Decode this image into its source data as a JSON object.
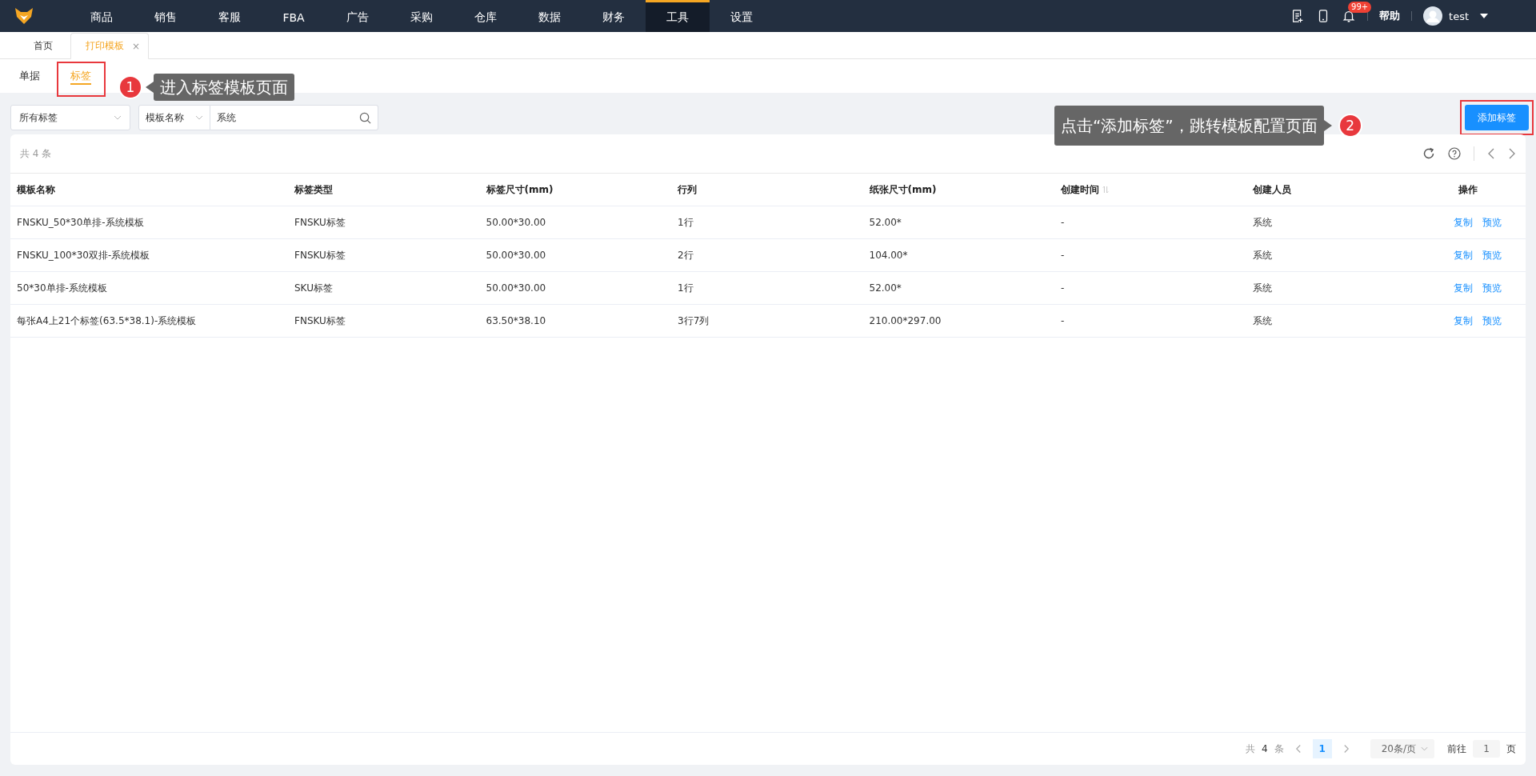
{
  "nav": {
    "items": [
      {
        "label": "商品",
        "selected": false
      },
      {
        "label": "销售",
        "selected": false
      },
      {
        "label": "客服",
        "selected": false
      },
      {
        "label": "FBA",
        "selected": false
      },
      {
        "label": "广告",
        "selected": false
      },
      {
        "label": "采购",
        "selected": false
      },
      {
        "label": "仓库",
        "selected": false
      },
      {
        "label": "数据",
        "selected": false
      },
      {
        "label": "财务",
        "selected": false
      },
      {
        "label": "工具",
        "selected": true
      },
      {
        "label": "设置",
        "selected": false
      }
    ],
    "notification_badge": "99+",
    "help": "帮助",
    "user": "test"
  },
  "page_tabs": [
    {
      "label": "首页",
      "selected": false,
      "closable": false
    },
    {
      "label": "打印模板",
      "selected": true,
      "closable": true
    }
  ],
  "close_mark": "×",
  "sub_tabs": [
    {
      "label": "单据",
      "selected": false
    },
    {
      "label": "标签",
      "selected": true
    }
  ],
  "filters": {
    "type_select": "所有标签",
    "field_select": "模板名称",
    "search_value": "系统"
  },
  "add_button": "添加标签",
  "total": "共 4 条",
  "table": {
    "columns": [
      "模板名称",
      "标签类型",
      "标签尺寸(mm)",
      "行列",
      "纸张尺寸(mm)",
      "创建时间",
      "创建人员",
      "操作"
    ],
    "rows": [
      {
        "cells": [
          "FNSKU_50*30单排-系统模板",
          "FNSKU标签",
          "50.00*30.00",
          "1行",
          "52.00*",
          "-",
          "系统"
        ],
        "actions": [
          "复制",
          "预览"
        ]
      },
      {
        "cells": [
          "FNSKU_100*30双排-系统模板",
          "FNSKU标签",
          "50.00*30.00",
          "2行",
          "104.00*",
          "-",
          "系统"
        ],
        "actions": [
          "复制",
          "预览"
        ]
      },
      {
        "cells": [
          "50*30单排-系统模板",
          "SKU标签",
          "50.00*30.00",
          "1行",
          "52.00*",
          "-",
          "系统"
        ],
        "actions": [
          "复制",
          "预览"
        ]
      },
      {
        "cells": [
          "每张A4上21个标签(63.5*38.1)-系统模板",
          "FNSKU标签",
          "63.50*38.10",
          "3行7列",
          "210.00*297.00",
          "-",
          "系统"
        ],
        "actions": [
          "复制",
          "预览"
        ]
      }
    ]
  },
  "pagination": {
    "total_prefix": "共",
    "total": "4",
    "total_suffix": "条",
    "pages": [
      {
        "label": "1",
        "selected": true
      }
    ],
    "page_size": "20条/页",
    "goto_label": "前往",
    "goto_value": "1",
    "goto_suffix": "页"
  },
  "annotations": [
    {
      "number": "1",
      "text": "进入标签模板页面"
    },
    {
      "number": "2",
      "text": "点击“添加标签”，跳转模板配置页面"
    }
  ]
}
